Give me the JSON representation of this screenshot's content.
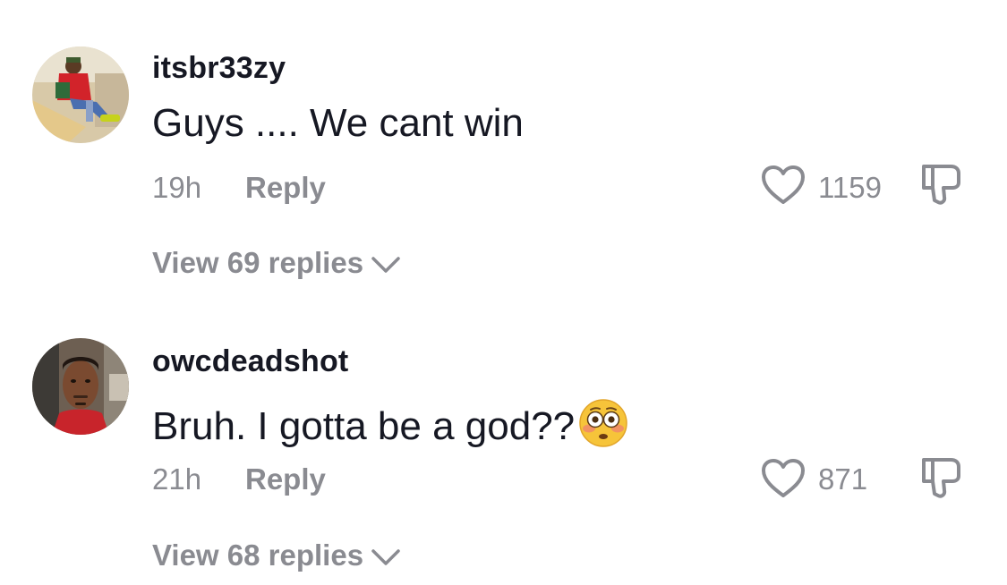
{
  "comments": [
    {
      "username": "itsbr33zy",
      "text": "Guys .... We cant win",
      "time": "19h",
      "reply_label": "Reply",
      "likes": "1159",
      "view_replies": "View 69 replies",
      "avatar_desc": "avatar-photo"
    },
    {
      "username": "owcdeadshot",
      "text": "Bruh. I gotta be a god??",
      "emoji": "flushed-face",
      "time": "21h",
      "reply_label": "Reply",
      "likes": "871",
      "view_replies": "View 68 replies",
      "avatar_desc": "avatar-photo"
    }
  ],
  "colors": {
    "primary_text": "#161823",
    "secondary_text": "#8a8b91"
  },
  "icons": {
    "like": "heart-outline-icon",
    "dislike": "thumbs-down-outline-icon",
    "expand": "chevron-down-icon"
  }
}
